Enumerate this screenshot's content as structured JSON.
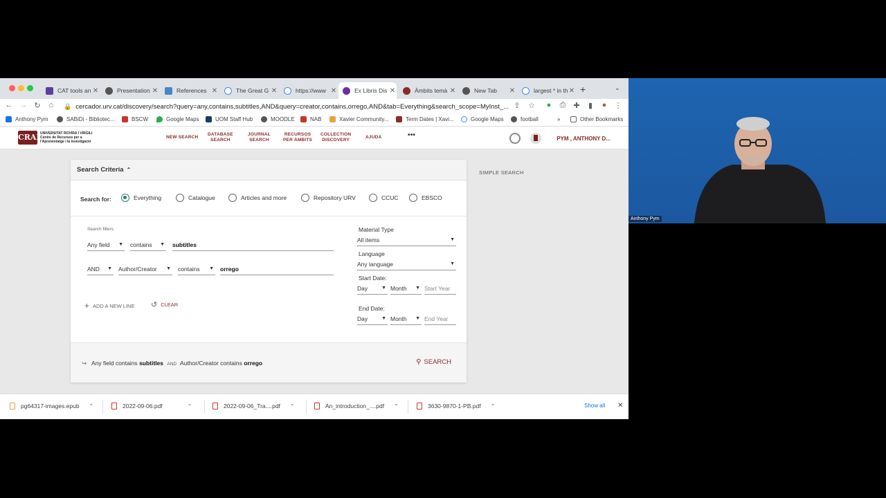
{
  "browser": {
    "tabs": [
      {
        "title": "CAT tools an",
        "color": "#5b3fa0"
      },
      {
        "title": "Presentation",
        "color": "#555555"
      },
      {
        "title": "References",
        "color": "#4a86c5"
      },
      {
        "title": "The Great G",
        "color": "#4285f4"
      },
      {
        "title": "https://www",
        "color": "#4285f4"
      },
      {
        "title": "Ex Libris Dis",
        "color": "#6b2fa0"
      },
      {
        "title": "Àmbits temà",
        "color": "#8a2a2a"
      },
      {
        "title": "New Tab",
        "color": "#555555"
      },
      {
        "title": "largest * in th",
        "color": "#4285f4"
      }
    ],
    "url": "cercador.urv.cat/discovery/search?query=any,contains,subtitles,AND&query=creator,contains,orrego,AND&tab=Everything&search_scope=MyInst_...",
    "bookmarks": [
      {
        "label": "Anthony Pym",
        "color": "#1a73e8"
      },
      {
        "label": "SABiDi - Bibliotec...",
        "color": "#555555"
      },
      {
        "label": "BSCW",
        "color": "#c5372c"
      },
      {
        "label": "Google Maps",
        "color": "#34a853"
      },
      {
        "label": "UOM Staff Hub",
        "color": "#1a3a6b"
      },
      {
        "label": "MOODLE",
        "color": "#555555"
      },
      {
        "label": "NAB",
        "color": "#c5372c"
      },
      {
        "label": "Xavier Community...",
        "color": "#e8a33d"
      },
      {
        "label": "Term Dates | Xavi...",
        "color": "#8a2a2a"
      },
      {
        "label": "Google Maps",
        "color": "#4285f4"
      },
      {
        "label": "football",
        "color": "#555555"
      }
    ],
    "bookmarks_more": "»",
    "other_bookmarks": "Other Bookmarks"
  },
  "site": {
    "logo_text": "UNIVERSITAT ROVIRA I VIRGILI Centre de Recursos per a l'Aprenentatge i la Investigació",
    "logo_mark": "CRAI",
    "nav": [
      {
        "line1": "NEW SEARCH",
        "line2": ""
      },
      {
        "line1": "DATABASE",
        "line2": "SEARCH"
      },
      {
        "line1": "JOURNAL",
        "line2": "SEARCH"
      },
      {
        "line1": "RECURSOS",
        "line2": "PER ÀMBITS"
      },
      {
        "line1": "COLLECTION",
        "line2": "DISCOVERY"
      },
      {
        "line1": "AJUDA",
        "line2": ""
      }
    ],
    "more": "•••",
    "user": "PYM , ANTHONY D..."
  },
  "search": {
    "title": "Search Criteria",
    "search_for_label": "Search for:",
    "scopes": [
      "Everything",
      "Catalogue",
      "Articles and more",
      "Repository URV",
      "CCUC",
      "EBSCO"
    ],
    "selected_scope": "Everything",
    "filters_label": "Search filters",
    "line1": {
      "field": "Any field",
      "op": "contains",
      "value": "subtitles"
    },
    "line2": {
      "bool": "AND",
      "field": "Author/Creator",
      "op": "contains",
      "value": "orrego"
    },
    "add_line": "ADD A NEW LINE",
    "clear": "CLEAR",
    "material_type_label": "Material Type",
    "material_type": "All items",
    "language_label": "Language",
    "language": "Any language",
    "start_date_label": "Start Date:",
    "end_date_label": "End Date:",
    "day": "Day",
    "month": "Month",
    "start_year": "Start Year",
    "end_year": "End Year",
    "summary": {
      "f1": "Any field",
      "op1": "contains",
      "v1": "subtitles",
      "bool": "AND",
      "f2": "Author/Creator",
      "op2": "contains",
      "v2": "orrego"
    },
    "search_button": "SEARCH",
    "simple_search": "SIMPLE SEARCH"
  },
  "downloads": {
    "items": [
      "pg64317-images.epub",
      "2022-09-06.pdf",
      "2022-09-06_Tra....pdf",
      "An_introduction_....pdf",
      "3630-9870-1-PB.pdf"
    ],
    "show_all": "Show all"
  },
  "webcam": {
    "name": "Anthony Pym"
  }
}
